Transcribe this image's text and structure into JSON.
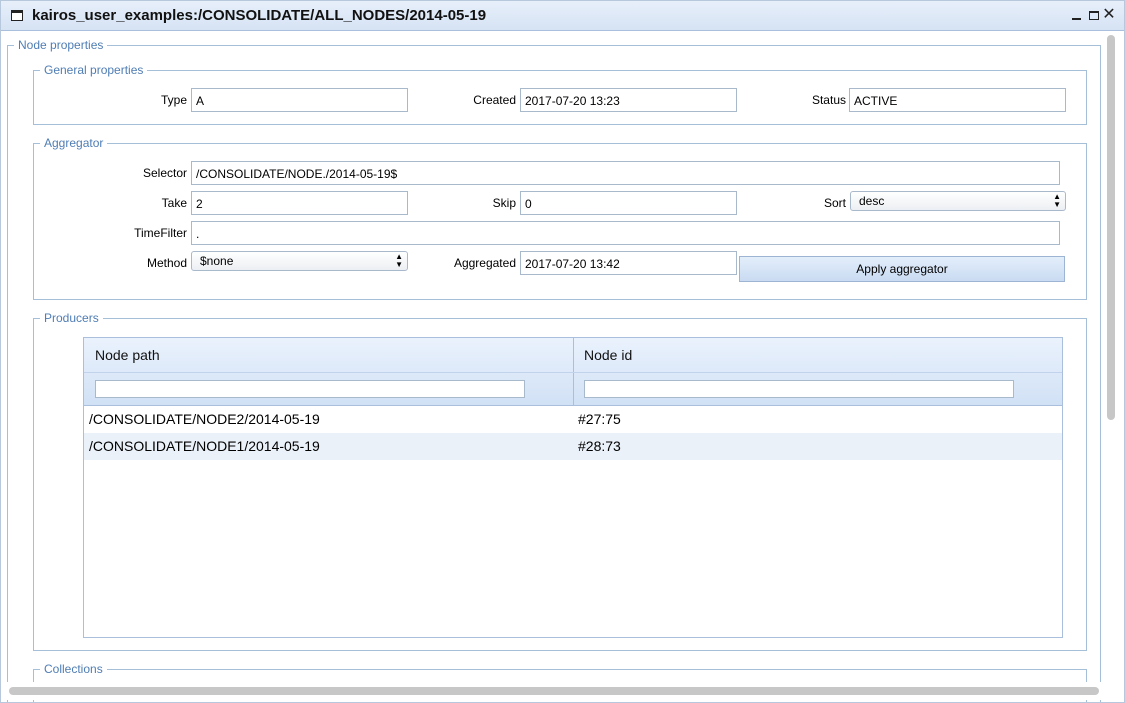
{
  "window": {
    "title": "kairos_user_examples:/CONSOLIDATE/ALL_NODES/2014-05-19",
    "minimize_icon": "minimize-icon",
    "maximize_icon": "maximize-icon",
    "close_icon": "close-icon",
    "close_glyph": "✕"
  },
  "node_properties": {
    "legend": "Node properties",
    "general": {
      "legend": "General properties",
      "type_label": "Type",
      "type_value": "A",
      "created_label": "Created",
      "created_value": "2017-07-20 13:23",
      "status_label": "Status",
      "status_value": "ACTIVE"
    },
    "aggregator": {
      "legend": "Aggregator",
      "selector_label": "Selector",
      "selector_value": "/CONSOLIDATE/NODE./2014-05-19$",
      "take_label": "Take",
      "take_value": "2",
      "skip_label": "Skip",
      "skip_value": "0",
      "sort_label": "Sort",
      "sort_value": "desc",
      "timefilter_label": "TimeFilter",
      "timefilter_value": ".",
      "method_label": "Method",
      "method_value": "$none",
      "aggregated_label": "Aggregated",
      "aggregated_value": "2017-07-20 13:42",
      "apply_button": "Apply aggregator",
      "select_arrows": "▲▼"
    },
    "producers": {
      "legend": "Producers",
      "columns": [
        "Node path",
        "Node id"
      ],
      "rows": [
        {
          "path": "/CONSOLIDATE/NODE2/2014-05-19",
          "id": "#27:75"
        },
        {
          "path": "/CONSOLIDATE/NODE1/2014-05-19",
          "id": "#28:73"
        }
      ]
    },
    "collections": {
      "legend": "Collections"
    }
  },
  "colors": {
    "accent": "#4f7db4",
    "header_bg": "#d6e3f4",
    "row_alt": "#ebf1f9"
  }
}
